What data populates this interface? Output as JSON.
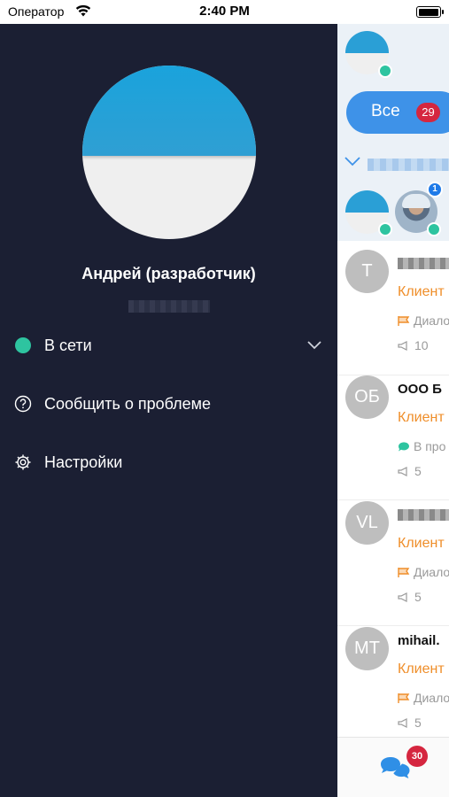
{
  "status_bar": {
    "carrier": "Оператор",
    "time": "2:40 PM"
  },
  "drawer": {
    "user_name": "Андрей (разработчик)",
    "status_label": "В сети",
    "report_label": "Сообщить о проблеме",
    "settings_label": "Настройки"
  },
  "panel": {
    "filter_label": "Все",
    "filter_count": "29",
    "group_unread": "1",
    "conversations": [
      {
        "initials": "T",
        "title": "",
        "client": "Клиент",
        "status": "Диало",
        "views": "10",
        "status_icon": "flag-icon"
      },
      {
        "initials": "ОБ",
        "title": "ООО Б",
        "client": "Клиент",
        "status": "В про",
        "views": "5",
        "status_icon": "chat-bubble-icon"
      },
      {
        "initials": "VL",
        "title": "",
        "client": "Клиент",
        "status": "Диало",
        "views": "5",
        "status_icon": "flag-icon"
      },
      {
        "initials": "MT",
        "title": "mihail.",
        "client": "Клиент",
        "status": "Диало",
        "views": "5",
        "status_icon": "flag-icon"
      }
    ],
    "bottom_badge": "30"
  },
  "colors": {
    "drawer_bg": "#1b1f33",
    "online": "#2ec4a0",
    "accent_blue": "#3e92e8",
    "badge_red": "#d5263f",
    "client_orange": "#ef8e2a"
  }
}
